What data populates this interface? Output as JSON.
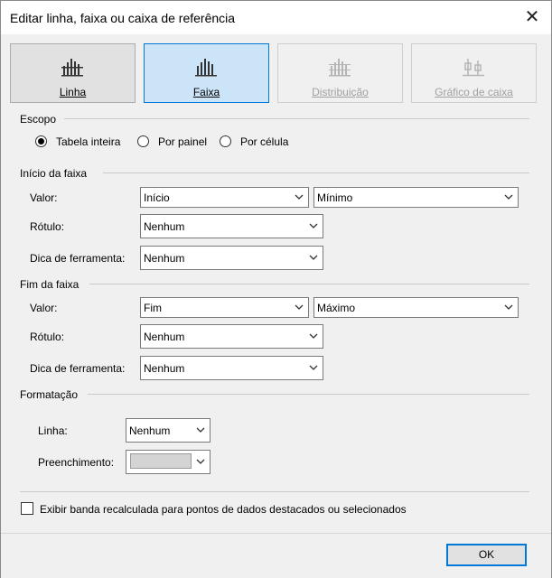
{
  "dialog": {
    "title": "Editar linha, faixa ou caixa de referência",
    "close_glyph": "✕"
  },
  "tiles": [
    {
      "label": "Linha",
      "state": "normal",
      "icon": "bar-chart-line-icon"
    },
    {
      "label": "Faixa",
      "state": "selected",
      "icon": "bar-chart-band-icon"
    },
    {
      "label": "Distribuição",
      "state": "disabled",
      "icon": "bar-chart-distribution-icon"
    },
    {
      "label": "Gráfico de caixa",
      "state": "disabled",
      "icon": "box-plot-icon"
    }
  ],
  "scope": {
    "heading": "Escopo",
    "options": [
      {
        "label": "Tabela inteira",
        "checked": true
      },
      {
        "label": "Por painel",
        "checked": false
      },
      {
        "label": "Por célula",
        "checked": false
      }
    ]
  },
  "band_start": {
    "heading": "Início da faixa",
    "value_label": "Valor:",
    "value_field": "Início",
    "value_agg": "Mínimo",
    "label_label": "Rótulo:",
    "label_value": "Nenhum",
    "tooltip_label": "Dica de ferramenta:",
    "tooltip_value": "Nenhum"
  },
  "band_end": {
    "heading": "Fim da faixa",
    "value_label": "Valor:",
    "value_field": "Fim",
    "value_agg": "Máximo",
    "label_label": "Rótulo:",
    "label_value": "Nenhum",
    "tooltip_label": "Dica de ferramenta:",
    "tooltip_value": "Nenhum"
  },
  "formatting": {
    "heading": "Formatação",
    "line_label": "Linha:",
    "line_value": "Nenhum",
    "fill_label": "Preenchimento:",
    "fill_color": "#d4d4d4"
  },
  "recalc_checkbox": {
    "label": "Exibir banda recalculada para pontos de dados destacados ou selecionados",
    "checked": false
  },
  "footer": {
    "ok_label": "OK"
  },
  "colors": {
    "accent": "#0078d7",
    "selected_tile": "#cce4f7",
    "panel_bg": "#f0f0f0"
  }
}
